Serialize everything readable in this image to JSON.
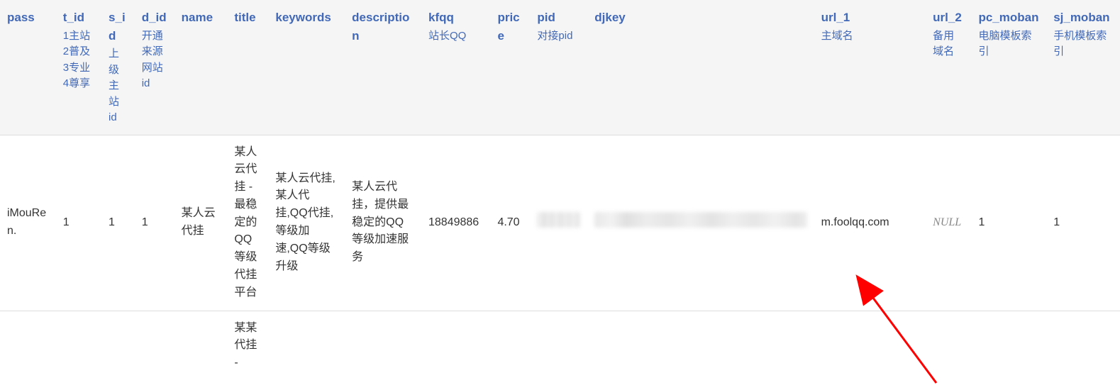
{
  "columns": {
    "pass": {
      "label": "pass",
      "sub": ""
    },
    "t_id": {
      "label": "t_id",
      "sub": "1主站2普及3专业4尊享"
    },
    "s_id": {
      "label": "s_id",
      "sub": "上级主站id"
    },
    "d_id": {
      "label": "d_id",
      "sub": "开通来源网站id"
    },
    "name": {
      "label": "name",
      "sub": ""
    },
    "title": {
      "label": "title",
      "sub": ""
    },
    "keywords": {
      "label": "keywords",
      "sub": ""
    },
    "description": {
      "label": "description",
      "sub": ""
    },
    "kfqq": {
      "label": "kfqq",
      "sub": "站长QQ"
    },
    "price": {
      "label": "price",
      "sub": ""
    },
    "pid": {
      "label": "pid",
      "sub": "对接pid"
    },
    "djkey": {
      "label": "djkey",
      "sub": ""
    },
    "url_1": {
      "label": "url_1",
      "sub": "主域名"
    },
    "url_2": {
      "label": "url_2",
      "sub": "备用域名"
    },
    "pc_moban": {
      "label": "pc_moban",
      "sub": "电脑模板索引"
    },
    "sj_moban": {
      "label": "sj_moban",
      "sub": "手机模板索引"
    }
  },
  "rows": [
    {
      "pass": "iMouRen.",
      "t_id": "1",
      "s_id": "1",
      "d_id": "1",
      "name": "某人云代挂",
      "title": "某人云代挂 - 最稳定的QQ等级代挂平台",
      "keywords": "某人云代挂,某人代挂,QQ代挂,等级加速,QQ等级升级",
      "description": "某人云代挂，提供最稳定的QQ等级加速服务",
      "kfqq": "18849886",
      "price": "4.70",
      "pid": "",
      "djkey": "(redacted)",
      "url_1": "m.foolqq.com",
      "url_2": "NULL",
      "pc_moban": "1",
      "sj_moban": "1"
    },
    {
      "pass": "",
      "t_id": "",
      "s_id": "",
      "d_id": "",
      "name": "",
      "title": "某某代挂 -",
      "keywords": "",
      "description": "",
      "kfqq": "",
      "price": "",
      "pid": "",
      "djkey": "",
      "url_1": "",
      "url_2": "",
      "pc_moban": "",
      "sj_moban": ""
    }
  ]
}
